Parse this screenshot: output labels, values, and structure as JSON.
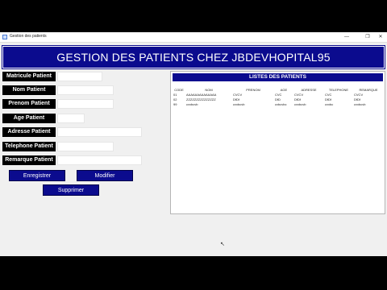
{
  "window": {
    "title": "Gestion des patients",
    "controls": {
      "minimize": "—",
      "maximize": "❐",
      "close": "✕"
    }
  },
  "header": {
    "title": "GESTION DES PATIENTS CHEZ JBDEVHOPITAL95"
  },
  "form": {
    "fields": [
      {
        "label": "Matricule Patient",
        "value": ""
      },
      {
        "label": "Nom Patient",
        "value": ""
      },
      {
        "label": "Prenom Patient",
        "value": ""
      },
      {
        "label": "Age Patient",
        "value": ""
      },
      {
        "label": "Adresse Patient",
        "value": ""
      },
      {
        "label": "Telephone Patient",
        "value": ""
      },
      {
        "label": "Remarque Patient",
        "value": ""
      }
    ],
    "buttons": {
      "save": "Enregistrer",
      "edit": "Modifier",
      "delete": "Supprimer"
    }
  },
  "list": {
    "title": "LISTES DES PATIENTS",
    "columns": [
      "CODE",
      "NOM",
      "PRENOM",
      "AGE",
      "ADRESSE",
      "TELEPHONE",
      "REMARQUE"
    ],
    "rows": [
      [
        "01",
        "AAAAAAAAAAAAAA",
        "CVCV",
        "CVC",
        "CVCV",
        "CVC",
        "CVCV"
      ],
      [
        "02",
        "ZZZZZZZZZZZZZZZ",
        "DfDf",
        "DfD",
        "DfDf",
        "DfDf",
        "DfDf"
      ],
      [
        "99",
        "cvxbcvb",
        "cvxbcvb",
        "cvbcvbc",
        "cvxbcvb",
        "cvxbc",
        "cvxbcvb"
      ]
    ]
  },
  "icons": {
    "app": "window-app-icon",
    "cursor": "mouse-cursor-icon"
  },
  "colors": {
    "accent": "#0b0b8e",
    "label_bg": "#000000",
    "window_bg": "#f0f0f0"
  }
}
